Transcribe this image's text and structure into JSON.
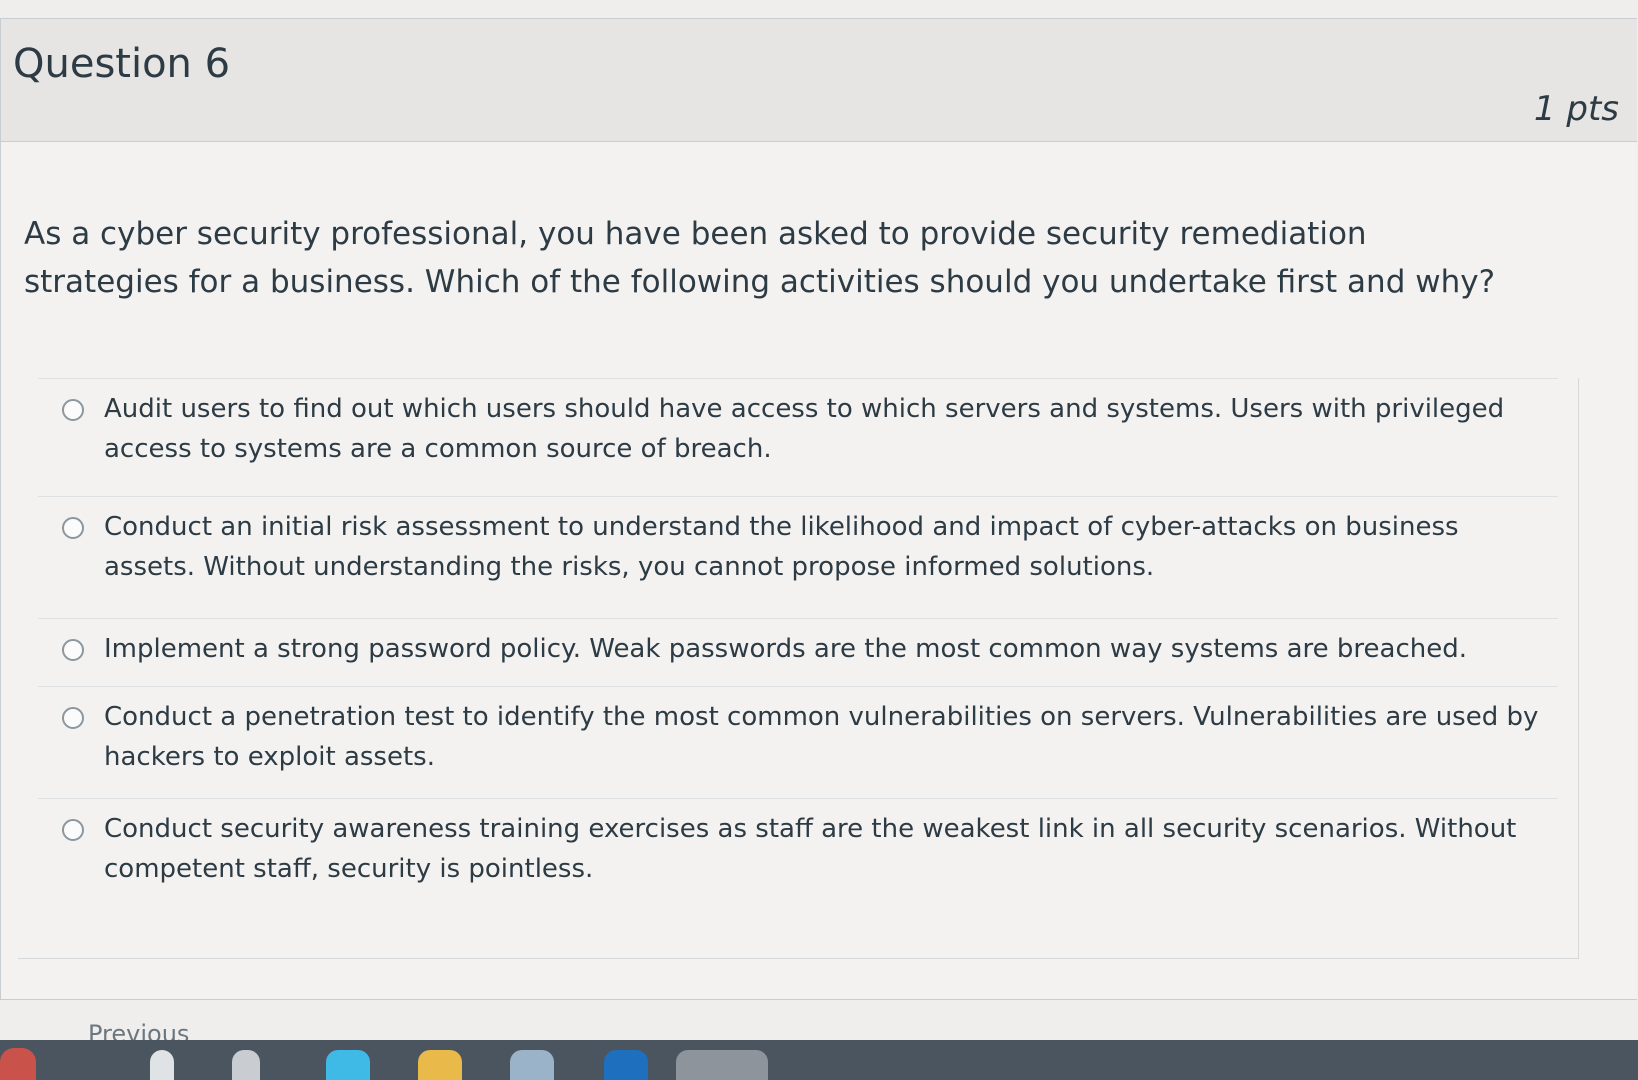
{
  "question": {
    "title": "Question 6",
    "points": "1 pts",
    "text": "As a cyber security professional, you have been asked to provide security remediation strategies for a business. Which of the following activities should you undertake first and why?"
  },
  "answers": [
    {
      "label": "Audit users to find out which users should have access to which servers and systems. Users with privileged access to systems are a common source of breach."
    },
    {
      "label": "Conduct an initial risk assessment to understand the likelihood and impact of cyber-attacks on business assets. Without understanding the risks, you cannot propose informed solutions."
    },
    {
      "label": "Implement a strong password policy. Weak passwords are the most common way systems are breached."
    },
    {
      "label": "Conduct a penetration test to identify the most common vulnerabilities on servers. Vulnerabilities are used by hackers to exploit assets."
    },
    {
      "label": "Conduct security awareness training exercises as staff are the weakest link in all security scenarios. Without competent staff, security is pointless."
    }
  ],
  "navigation": {
    "previous_label": "Previous"
  },
  "colors": {
    "text": "#2d3b45",
    "header_bg": "#e6e5e4",
    "card_bg": "#f3f2f0",
    "taskbar": "#4b5560"
  }
}
